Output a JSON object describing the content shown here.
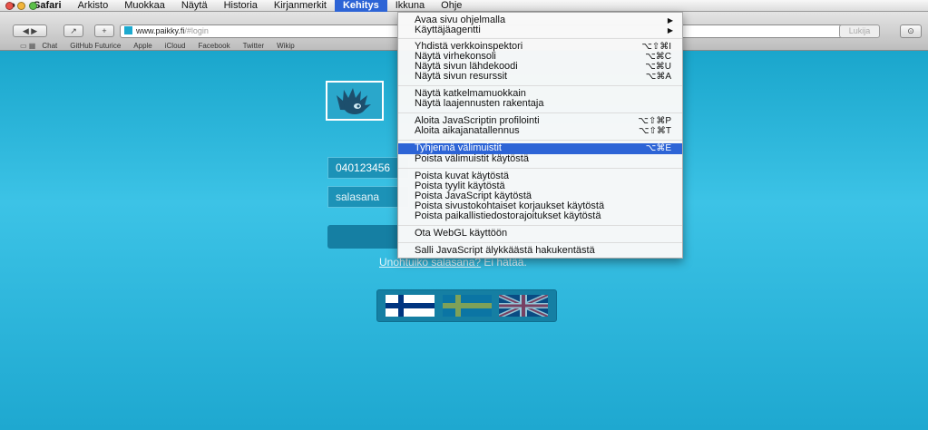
{
  "menubar": {
    "app": "Safari",
    "items": [
      "Arkisto",
      "Muokkaa",
      "Näytä",
      "Historia",
      "Kirjanmerkit",
      "Kehitys",
      "Ikkuna",
      "Ohje"
    ],
    "active": "Kehitys"
  },
  "browser": {
    "url_host": "www.paikky.fi",
    "url_path": "/#login",
    "reader_label": "Lukija",
    "bookmarks": [
      "Chat",
      "GitHub Futurice",
      "Apple",
      "iCloud",
      "Facebook",
      "Twitter",
      "Wikip"
    ]
  },
  "page": {
    "phone_value": "040123456",
    "password_placeholder": "salasana",
    "forgot_link": "Unohtuiko salasana?",
    "forgot_tail": " Ei hätää.",
    "languages": [
      "fi",
      "sv",
      "en"
    ]
  },
  "dev_menu": {
    "items": [
      {
        "label": "Avaa sivu ohjelmalla",
        "shortcut": "",
        "submenu": true
      },
      {
        "label": "Käyttäjäagentti",
        "shortcut": "",
        "submenu": true
      },
      {
        "label": "Yhdistä verkkoinspektori",
        "shortcut": "⌥⇧⌘I"
      },
      {
        "label": "Näytä virhekonsoli",
        "shortcut": "⌥⌘C"
      },
      {
        "label": "Näytä sivun lähdekoodi",
        "shortcut": "⌥⌘U"
      },
      {
        "label": "Näytä sivun resurssit",
        "shortcut": "⌥⌘A"
      },
      {
        "label": "Näytä katkelmamuokkain",
        "shortcut": ""
      },
      {
        "label": "Näytä laajennusten rakentaja",
        "shortcut": ""
      },
      {
        "label": "Aloita JavaScriptin profilointi",
        "shortcut": "⌥⇧⌘P"
      },
      {
        "label": "Aloita aikajanatallennus",
        "shortcut": "⌥⇧⌘T"
      },
      {
        "label": "Tyhjennä välimuistit",
        "shortcut": "⌥⌘E",
        "highlighted": true
      },
      {
        "label": "Poista välimuistit käytöstä",
        "shortcut": ""
      },
      {
        "label": "Poista kuvat käytöstä",
        "shortcut": ""
      },
      {
        "label": "Poista tyylit käytöstä",
        "shortcut": ""
      },
      {
        "label": "Poista JavaScript käytöstä",
        "shortcut": ""
      },
      {
        "label": "Poista sivustokohtaiset korjaukset käytöstä",
        "shortcut": ""
      },
      {
        "label": "Poista paikallistiedostorajoitukset käytöstä",
        "shortcut": ""
      },
      {
        "label": "Ota WebGL käyttöön",
        "shortcut": ""
      },
      {
        "label": "Salli JavaScript älykkäästä hakukentästä",
        "shortcut": ""
      }
    ]
  },
  "colors": {
    "page_background": "#1ba9cf",
    "menu_highlight": "#2d64d6",
    "button": "#157fa3"
  }
}
